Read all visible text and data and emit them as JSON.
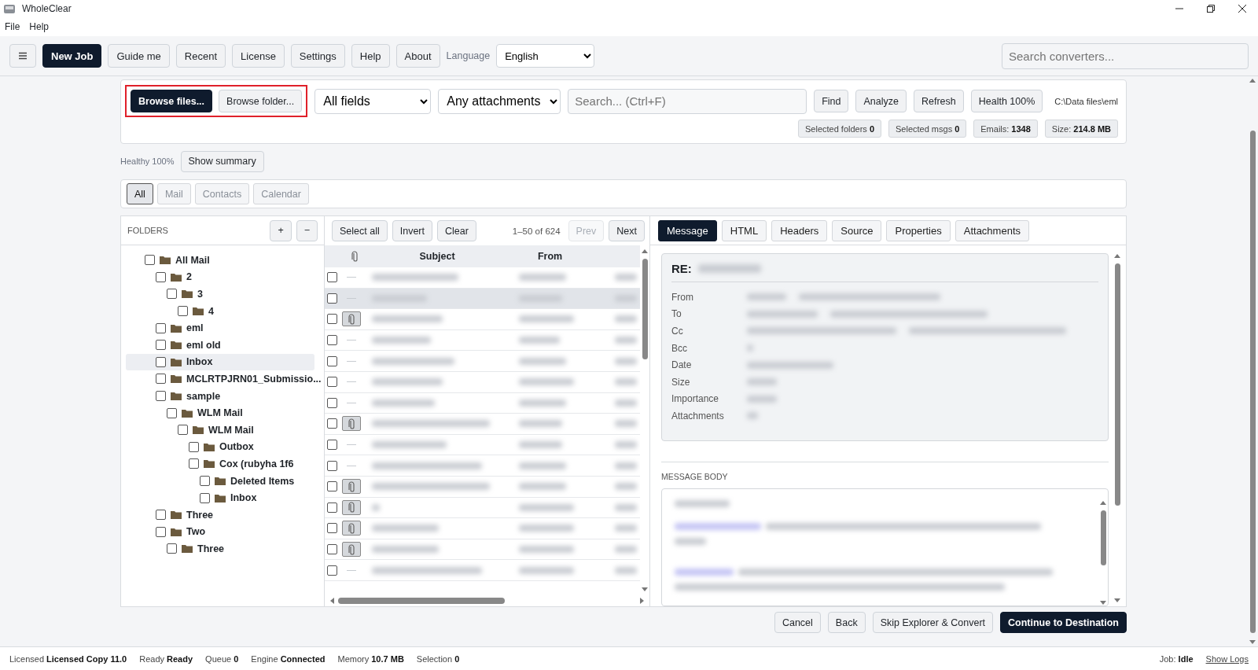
{
  "window": {
    "title": "WholeClear"
  },
  "menu": [
    "File",
    "Help"
  ],
  "toolbar": {
    "buttons": [
      {
        "label": "New Job",
        "primary": true
      },
      {
        "label": "Guide me",
        "primary": false
      },
      {
        "label": "Recent",
        "primary": false
      },
      {
        "label": "License",
        "primary": false
      },
      {
        "label": "Settings",
        "primary": false
      },
      {
        "label": "Help",
        "primary": false
      },
      {
        "label": "About",
        "primary": false
      }
    ],
    "language_label": "Language",
    "language": "English",
    "search": {
      "placeholder": "Search converters..."
    }
  },
  "source": {
    "highlighted": true,
    "buttons": [
      {
        "label": "Browse files...",
        "primary": true
      },
      {
        "label": "Browse folder...",
        "primary": false
      }
    ],
    "field_filter": "All fields",
    "attachment_filter": "Any attachments",
    "search": {
      "placeholder": "Search... (Ctrl+F)"
    },
    "actions": [
      "Find",
      "Analyze",
      "Refresh",
      "Health 100%"
    ],
    "path": "C:\\Data files\\eml",
    "stats": [
      {
        "label": "Selected folders",
        "value": "0"
      },
      {
        "label": "Selected msgs",
        "value": "0"
      },
      {
        "label": "Emails:",
        "value": "1348"
      },
      {
        "label": "Size:",
        "value": "214.8 MB"
      }
    ]
  },
  "health": {
    "text": "Healthy 100%",
    "button": "Show summary"
  },
  "type_tabs": [
    {
      "label": "All",
      "selected": true
    },
    {
      "label": "Mail",
      "selected": false
    },
    {
      "label": "Contacts",
      "selected": false
    },
    {
      "label": "Calendar",
      "selected": false
    }
  ],
  "folders": {
    "title": "FOLDERS",
    "buttons": [
      "+",
      "−"
    ],
    "tree": [
      {
        "name": "All Mail",
        "checked": false,
        "selected": false,
        "children": [
          {
            "name": "2",
            "checked": false,
            "selected": false,
            "children": [
              {
                "name": "3",
                "checked": false,
                "selected": false,
                "children": [
                  {
                    "name": "4",
                    "checked": false,
                    "selected": false
                  }
                ]
              }
            ]
          },
          {
            "name": "eml",
            "checked": false,
            "selected": false
          },
          {
            "name": "eml old",
            "checked": false,
            "selected": false
          },
          {
            "name": "Inbox",
            "checked": false,
            "selected": true
          },
          {
            "name": "MCLRTPJRN01_Submissio...",
            "checked": false,
            "selected": false
          },
          {
            "name": "sample",
            "checked": false,
            "selected": false,
            "children": [
              {
                "name": "WLM Mail",
                "checked": false,
                "selected": false,
                "children": [
                  {
                    "name": "WLM Mail",
                    "checked": false,
                    "selected": false,
                    "children": [
                      {
                        "name": "Outbox",
                        "checked": false,
                        "selected": false
                      },
                      {
                        "name": "Cox (rubyha 1f6",
                        "checked": false,
                        "selected": false,
                        "children": [
                          {
                            "name": "Deleted Items",
                            "checked": false,
                            "selected": false
                          },
                          {
                            "name": "Inbox",
                            "checked": false,
                            "selected": false
                          }
                        ]
                      }
                    ]
                  }
                ]
              }
            ]
          },
          {
            "name": "Three",
            "checked": false,
            "selected": false
          },
          {
            "name": "Two",
            "checked": false,
            "selected": false,
            "children": [
              {
                "name": "Three",
                "checked": false,
                "selected": false
              }
            ]
          }
        ]
      }
    ]
  },
  "message_list": {
    "buttons": [
      "Select all",
      "Invert",
      "Clear"
    ],
    "range": "1–50 of 624",
    "prev": {
      "label": "Prev",
      "disabled": true
    },
    "next": {
      "label": "Next",
      "disabled": false
    },
    "columns": [
      "Subject",
      "From"
    ],
    "rows": [
      {
        "attachment": false,
        "selected": false,
        "checked": false
      },
      {
        "attachment": false,
        "selected": true,
        "checked": false
      },
      {
        "attachment": true,
        "selected": false,
        "checked": false
      },
      {
        "attachment": false,
        "selected": false,
        "checked": false
      },
      {
        "attachment": false,
        "selected": false,
        "checked": false
      },
      {
        "attachment": false,
        "selected": false,
        "checked": false
      },
      {
        "attachment": false,
        "selected": false,
        "checked": false
      },
      {
        "attachment": true,
        "selected": false,
        "checked": false
      },
      {
        "attachment": false,
        "selected": false,
        "checked": false
      },
      {
        "attachment": false,
        "selected": false,
        "checked": false
      },
      {
        "attachment": true,
        "selected": false,
        "checked": false
      },
      {
        "attachment": true,
        "selected": false,
        "checked": false
      },
      {
        "attachment": true,
        "selected": false,
        "checked": false
      },
      {
        "attachment": true,
        "selected": false,
        "checked": false
      },
      {
        "attachment": false,
        "selected": false,
        "checked": false
      }
    ]
  },
  "message_view": {
    "tabs": [
      {
        "label": "Message",
        "selected": true
      },
      {
        "label": "HTML",
        "selected": false
      },
      {
        "label": "Headers",
        "selected": false
      },
      {
        "label": "Source",
        "selected": false
      },
      {
        "label": "Properties",
        "selected": false
      },
      {
        "label": "Attachments",
        "selected": false
      }
    ],
    "subject_prefix": "RE:",
    "fields": [
      "From",
      "To",
      "Cc",
      "Bcc",
      "Date",
      "Size",
      "Importance",
      "Attachments"
    ],
    "body_title": "MESSAGE BODY"
  },
  "footer_buttons": [
    {
      "label": "Cancel",
      "primary": false
    },
    {
      "label": "Back",
      "primary": false
    },
    {
      "label": "Skip Explorer & Convert",
      "primary": false
    },
    {
      "label": "Continue to Destination",
      "primary": true
    }
  ],
  "status_bar": {
    "items": [
      {
        "label": "Licensed",
        "value": "Licensed Copy 11.0"
      },
      {
        "label": "Ready",
        "value": "Ready"
      },
      {
        "label": "Queue",
        "value": "0"
      },
      {
        "label": "Engine",
        "value": "Connected"
      },
      {
        "label": "Memory",
        "value": "10.7 MB"
      },
      {
        "label": "Selection",
        "value": "0"
      }
    ],
    "job_label": "Job:",
    "job": "Idle",
    "link": "Show Logs"
  }
}
